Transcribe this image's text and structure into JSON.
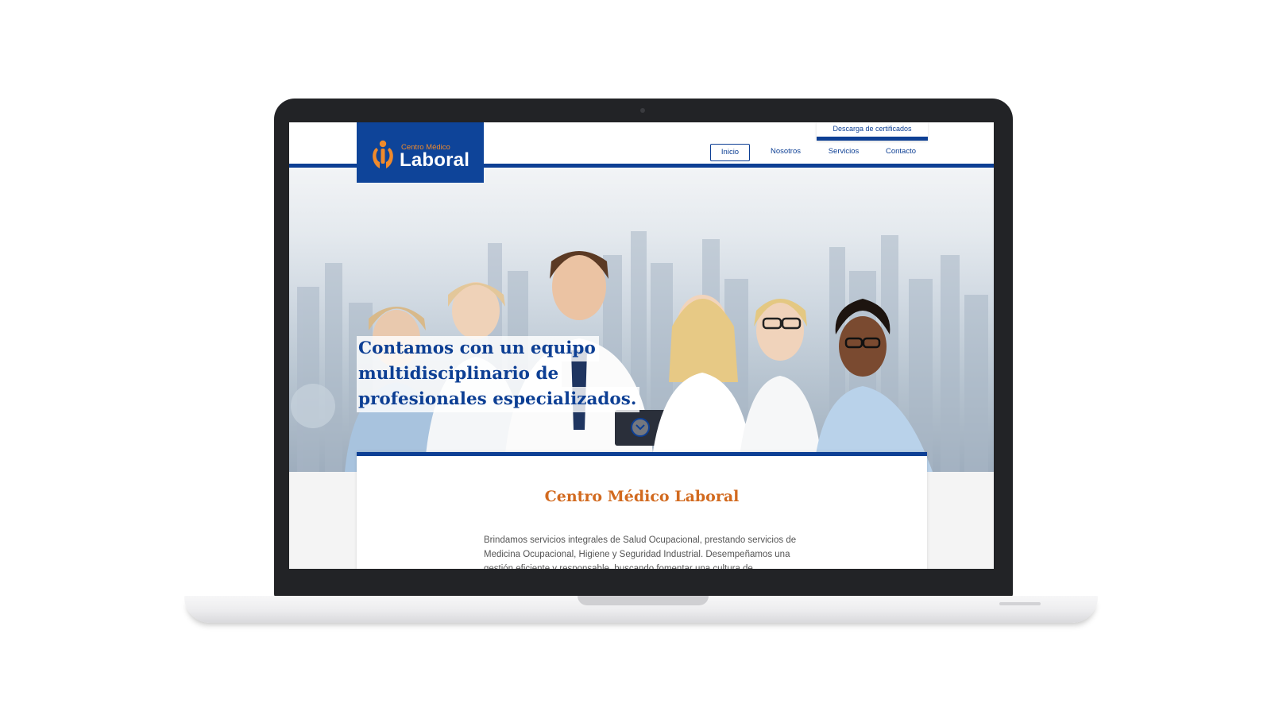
{
  "header": {
    "logo": {
      "small": "Centro Médico",
      "big": "Laboral"
    },
    "cert_button": "Descarga de certificados",
    "nav": [
      {
        "label": "Inicio",
        "active": true
      },
      {
        "label": "Nosotros",
        "active": false
      },
      {
        "label": "Servicios",
        "active": false
      },
      {
        "label": "Contacto",
        "active": false
      }
    ]
  },
  "hero": {
    "lines": [
      "Contamos con un equipo",
      "multidisciplinario de",
      "profesionales especializados."
    ],
    "scroll_icon": "chevron-down-icon"
  },
  "content": {
    "title": "Centro Médico Laboral",
    "body": "Brindamos servicios integrales de Salud Ocupacional, prestando servicios de Medicina Ocupacional, Higiene y Seguridad Industrial. Desempeñamos una gestión eficiente y responsable, buscando fomentar una cultura de"
  },
  "colors": {
    "brand_blue": "#0d3f94",
    "brand_orange": "#f08a2b",
    "title_orange": "#d26a1f"
  }
}
